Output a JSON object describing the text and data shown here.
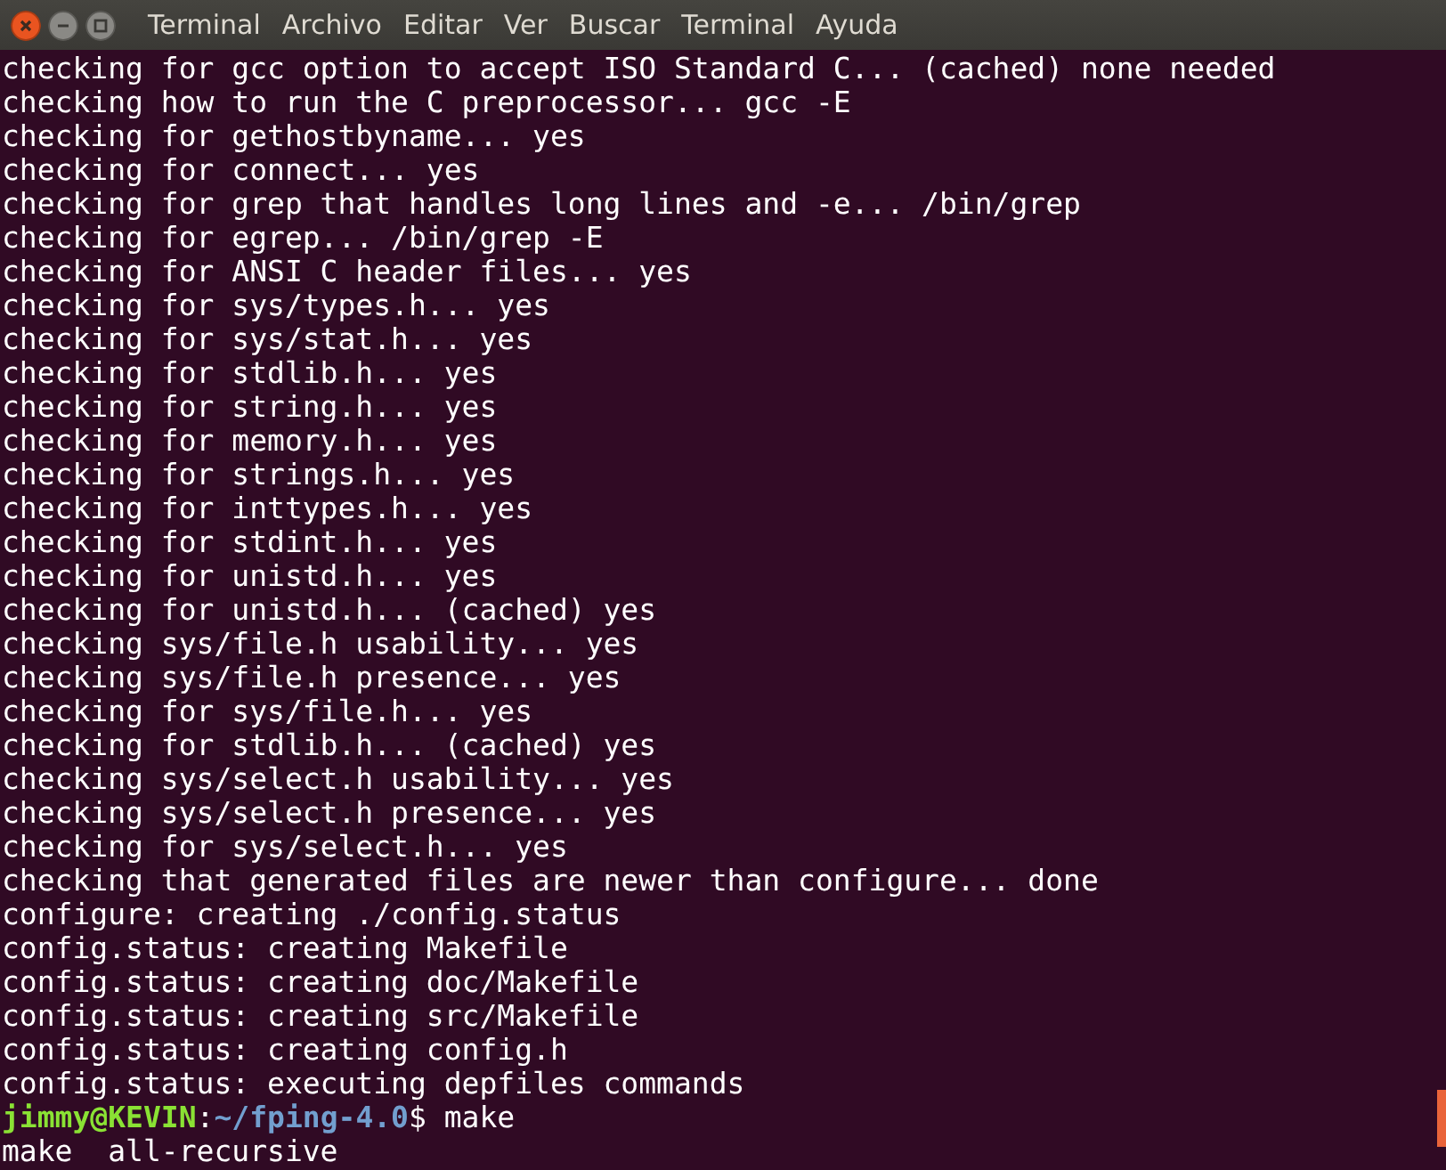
{
  "window": {
    "menu": [
      "Terminal",
      "Archivo",
      "Editar",
      "Ver",
      "Buscar",
      "Terminal",
      "Ayuda"
    ]
  },
  "lines": [
    {
      "kind": "output",
      "text": "checking for gcc option to accept ISO Standard C... (cached) none needed"
    },
    {
      "kind": "output",
      "text": "checking how to run the C preprocessor... gcc -E"
    },
    {
      "kind": "output",
      "text": "checking for gethostbyname... yes"
    },
    {
      "kind": "output",
      "text": "checking for connect... yes"
    },
    {
      "kind": "output",
      "text": "checking for grep that handles long lines and -e... /bin/grep"
    },
    {
      "kind": "output",
      "text": "checking for egrep... /bin/grep -E"
    },
    {
      "kind": "output",
      "text": "checking for ANSI C header files... yes"
    },
    {
      "kind": "output",
      "text": "checking for sys/types.h... yes"
    },
    {
      "kind": "output",
      "text": "checking for sys/stat.h... yes"
    },
    {
      "kind": "output",
      "text": "checking for stdlib.h... yes"
    },
    {
      "kind": "output",
      "text": "checking for string.h... yes"
    },
    {
      "kind": "output",
      "text": "checking for memory.h... yes"
    },
    {
      "kind": "output",
      "text": "checking for strings.h... yes"
    },
    {
      "kind": "output",
      "text": "checking for inttypes.h... yes"
    },
    {
      "kind": "output",
      "text": "checking for stdint.h... yes"
    },
    {
      "kind": "output",
      "text": "checking for unistd.h... yes"
    },
    {
      "kind": "output",
      "text": "checking for unistd.h... (cached) yes"
    },
    {
      "kind": "output",
      "text": "checking sys/file.h usability... yes"
    },
    {
      "kind": "output",
      "text": "checking sys/file.h presence... yes"
    },
    {
      "kind": "output",
      "text": "checking for sys/file.h... yes"
    },
    {
      "kind": "output",
      "text": "checking for stdlib.h... (cached) yes"
    },
    {
      "kind": "output",
      "text": "checking sys/select.h usability... yes"
    },
    {
      "kind": "output",
      "text": "checking sys/select.h presence... yes"
    },
    {
      "kind": "output",
      "text": "checking for sys/select.h... yes"
    },
    {
      "kind": "output",
      "text": "checking that generated files are newer than configure... done"
    },
    {
      "kind": "output",
      "text": "configure: creating ./config.status"
    },
    {
      "kind": "output",
      "text": "config.status: creating Makefile"
    },
    {
      "kind": "output",
      "text": "config.status: creating doc/Makefile"
    },
    {
      "kind": "output",
      "text": "config.status: creating src/Makefile"
    },
    {
      "kind": "output",
      "text": "config.status: creating config.h"
    },
    {
      "kind": "output",
      "text": "config.status: executing depfiles commands"
    },
    {
      "kind": "prompt",
      "user": "jimmy@KEVIN",
      "separator": ":",
      "path": "~/fping-4.0",
      "symbol": "$",
      "command": "make"
    },
    {
      "kind": "output",
      "text": "make  all-recursive"
    }
  ]
}
